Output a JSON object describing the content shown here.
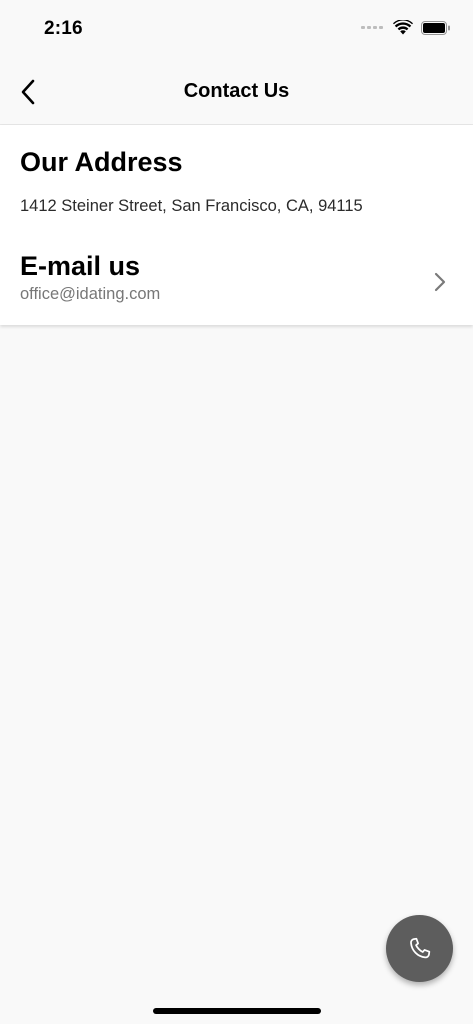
{
  "status_bar": {
    "time": "2:16"
  },
  "nav": {
    "title": "Contact Us"
  },
  "address": {
    "heading": "Our Address",
    "text": "1412 Steiner Street, San Francisco, CA, 94115"
  },
  "email": {
    "heading": "E-mail us",
    "value": "office@idating.com"
  },
  "icons": {
    "back": "chevron-left-icon",
    "email_arrow": "chevron-right-icon",
    "fab": "phone-icon",
    "wifi": "wifi-icon",
    "battery": "battery-icon"
  },
  "colors": {
    "background": "#f9f9f9",
    "card": "#ffffff",
    "fab": "#5d5d5d",
    "secondary_text": "#777777"
  }
}
